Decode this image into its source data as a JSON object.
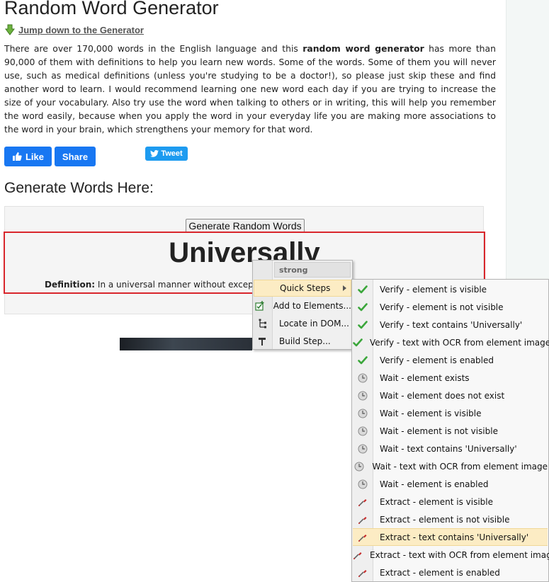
{
  "page": {
    "title": "Random Word Generator",
    "jump_link": "Jump down to the Generator",
    "intro_prefix": "There are over 170,000 words in the English language and this ",
    "intro_bold": "random word generator",
    "intro_suffix": " has more than 90,000 of them with definitions to help you learn new words. Some of the words. Some of them you will never use, such as medical definitions (unless you're studying to be a doctor!), so please just skip these and find another word to learn. I would recommend learning one new word each day if you are trying to increase the size of your vocabulary. Also try use the word when talking to others or in writing, this will help you remember the word easily, because when you apply the word in your everyday life you are making more associations to the word in your brain, which strengthens your memory for that word."
  },
  "social": {
    "like_label": "Like",
    "share_label": "Share",
    "tweet_label": "Tweet"
  },
  "generator": {
    "heading": "Generate Words Here:",
    "button_label": "Generate Random Words",
    "word": "Universally",
    "definition_label": "Definition:",
    "definition_text": "In a universal manner without exception a"
  },
  "context_menu": {
    "header": "strong",
    "items": [
      {
        "label": "Quick Steps",
        "icon": "none",
        "has_submenu": true
      },
      {
        "label": "Add to Elements...",
        "icon": "add-element-icon"
      },
      {
        "label": "Locate in DOM...",
        "icon": "tree-icon"
      },
      {
        "label": "Build Step...",
        "icon": "hammer-icon"
      }
    ]
  },
  "submenu": {
    "items": [
      {
        "label": "Verify - element is visible",
        "icon": "check-icon"
      },
      {
        "label": "Verify - element is not visible",
        "icon": "check-icon"
      },
      {
        "label": "Verify - text contains 'Universally'",
        "icon": "check-icon"
      },
      {
        "label": "Verify - text with OCR from element image",
        "icon": "check-icon"
      },
      {
        "label": "Verify - element is enabled",
        "icon": "check-icon"
      },
      {
        "label": "Wait - element exists",
        "icon": "clock-icon"
      },
      {
        "label": "Wait - element does not exist",
        "icon": "clock-icon"
      },
      {
        "label": "Wait - element is visible",
        "icon": "clock-icon"
      },
      {
        "label": "Wait - element is not visible",
        "icon": "clock-icon"
      },
      {
        "label": "Wait - text contains 'Universally'",
        "icon": "clock-icon"
      },
      {
        "label": "Wait - text with OCR from element image",
        "icon": "clock-icon"
      },
      {
        "label": "Wait - element is enabled",
        "icon": "clock-icon"
      },
      {
        "label": "Extract - element is visible",
        "icon": "pipette-icon"
      },
      {
        "label": "Extract - element is not visible",
        "icon": "pipette-icon"
      },
      {
        "label": "Extract - text contains 'Universally'",
        "icon": "pipette-icon"
      },
      {
        "label": "Extract - text with OCR from element image",
        "icon": "pipette-icon"
      },
      {
        "label": "Extract - element is enabled",
        "icon": "pipette-icon"
      }
    ],
    "highlighted_index": 14
  },
  "colors": {
    "facebook_blue": "#1877f2",
    "twitter_blue": "#1d9bf0",
    "selection_red": "#d9262c",
    "menu_highlight": "#fcecc4"
  }
}
